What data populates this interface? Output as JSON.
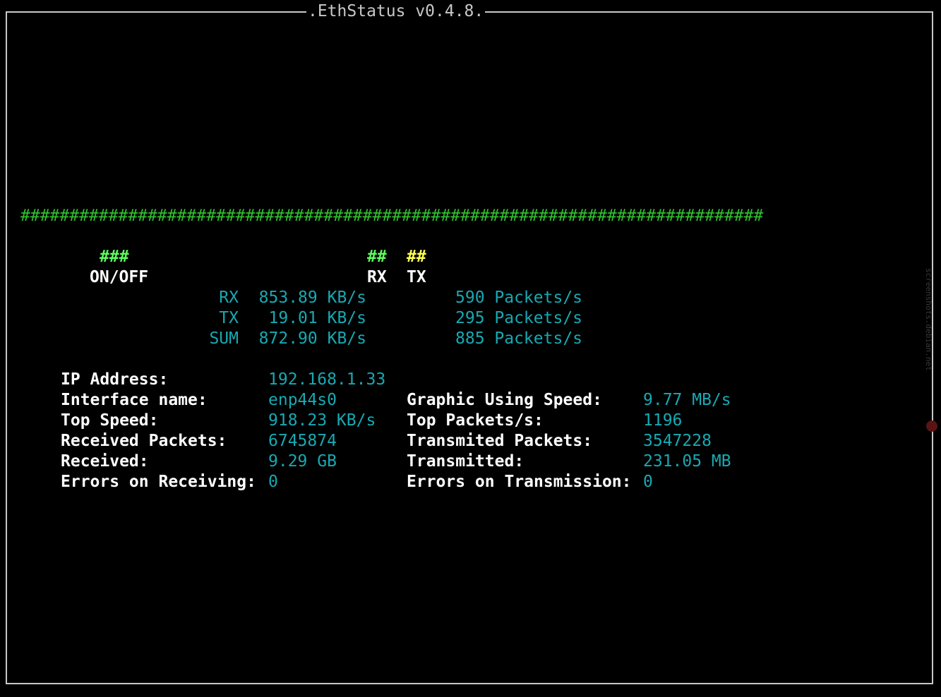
{
  "window": {
    "title": ".EthStatus v0.4.8."
  },
  "graph": {
    "bar": "############################################################################"
  },
  "legend": {
    "onoff_marks": "###",
    "onoff_label": "ON/OFF",
    "rx_marks": "##",
    "rx_label": "RX",
    "tx_marks": "##",
    "tx_label": "TX",
    "colors": {
      "onoff": "#5cff5c",
      "rx": "#5cff5c",
      "tx": "#ffff55"
    }
  },
  "speed": {
    "rx": {
      "label": "RX",
      "speed": "853.89 KB/s",
      "packets": "590 Packets/s"
    },
    "tx": {
      "label": "TX",
      "speed": "19.01 KB/s",
      "packets": "295 Packets/s"
    },
    "sum": {
      "label": "SUM",
      "speed": "872.90 KB/s",
      "packets": "885 Packets/s"
    }
  },
  "stats_left": [
    {
      "label": "IP Address:",
      "value": "192.168.1.33"
    },
    {
      "label": "Interface name:",
      "value": "enp44s0"
    },
    {
      "label": "Top Speed:",
      "value": "918.23 KB/s"
    },
    {
      "label": "Received Packets:",
      "value": "6745874"
    },
    {
      "label": "Received:",
      "value": "9.29 GB"
    },
    {
      "label": "Errors on Receiving:",
      "value": "0"
    }
  ],
  "stats_right": [
    {
      "label": "Graphic Using Speed:",
      "value": "9.77 MB/s"
    },
    {
      "label": "Top Packets/s:",
      "value": "1196"
    },
    {
      "label": "Transmited Packets:",
      "value": "3547228"
    },
    {
      "label": "Transmitted:",
      "value": "231.05 MB"
    },
    {
      "label": "Errors on Transmission:",
      "value": "0"
    }
  ],
  "watermark": {
    "text": "screenshots.debian.net"
  },
  "colors": {
    "background": "#000000",
    "border": "#c8c8c8",
    "graph": "#2fbf2f",
    "value": "#17a9b3",
    "label": "#ffffff"
  }
}
